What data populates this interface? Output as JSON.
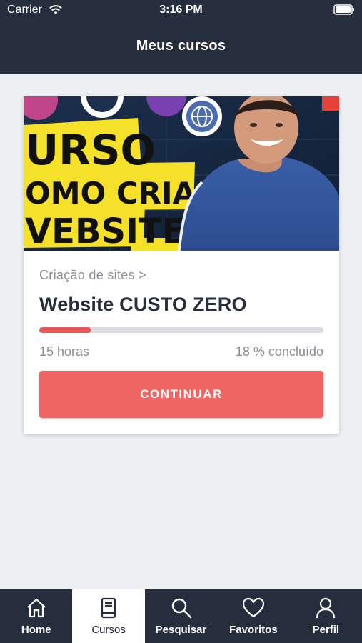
{
  "status_bar": {
    "carrier": "Carrier",
    "time": "3:16 PM"
  },
  "header": {
    "title": "Meus cursos"
  },
  "course": {
    "category": "Criação de sites >",
    "title": "Website CUSTO ZERO",
    "thumbnail_text": [
      "URSO",
      "OMO CRIAR",
      "VEBSITE"
    ],
    "progress": 0.18,
    "hours": "15 horas",
    "percent_label": "18 % concluído",
    "continue_label": "CONTINUAR"
  },
  "tabs": [
    {
      "label": "Home",
      "icon": "home-icon",
      "active": false
    },
    {
      "label": "Cursos",
      "icon": "book-icon",
      "active": true
    },
    {
      "label": "Pesquisar",
      "icon": "search-icon",
      "active": false
    },
    {
      "label": "Favoritos",
      "icon": "heart-icon",
      "active": false
    },
    {
      "label": "Perfil",
      "icon": "user-icon",
      "active": false
    }
  ],
  "colors": {
    "header": "#262d3d",
    "accent": "#ee6563",
    "progress": "#e8585a",
    "background": "#eef0f4"
  }
}
